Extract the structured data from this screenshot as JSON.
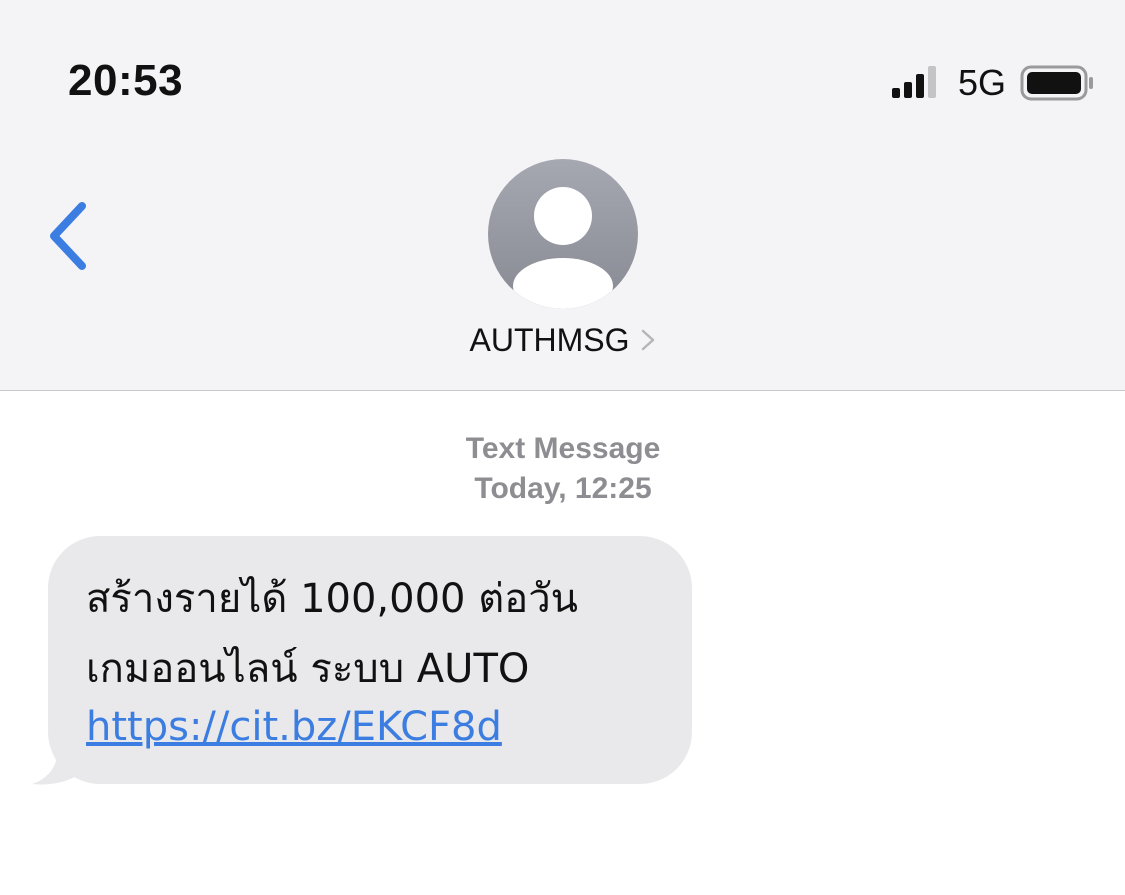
{
  "status_bar": {
    "time": "20:53",
    "network": "5G",
    "signal_icon": "signal-bars-icon",
    "battery_icon": "battery-icon"
  },
  "nav": {
    "back_icon": "chevron-left-icon",
    "contact_name": "AUTHMSG",
    "avatar_icon": "person-avatar-icon",
    "accent_color": "#3b7de0"
  },
  "conversation": {
    "meta_type": "Text Message",
    "meta_time": "Today, 12:25",
    "message": {
      "line1": "สร้างรายได้ 100,000 ต่อวัน",
      "line2": "เกมออนไลน์ ระบบ AUTO",
      "link": "https://cit.bz/EKCF8d"
    }
  }
}
